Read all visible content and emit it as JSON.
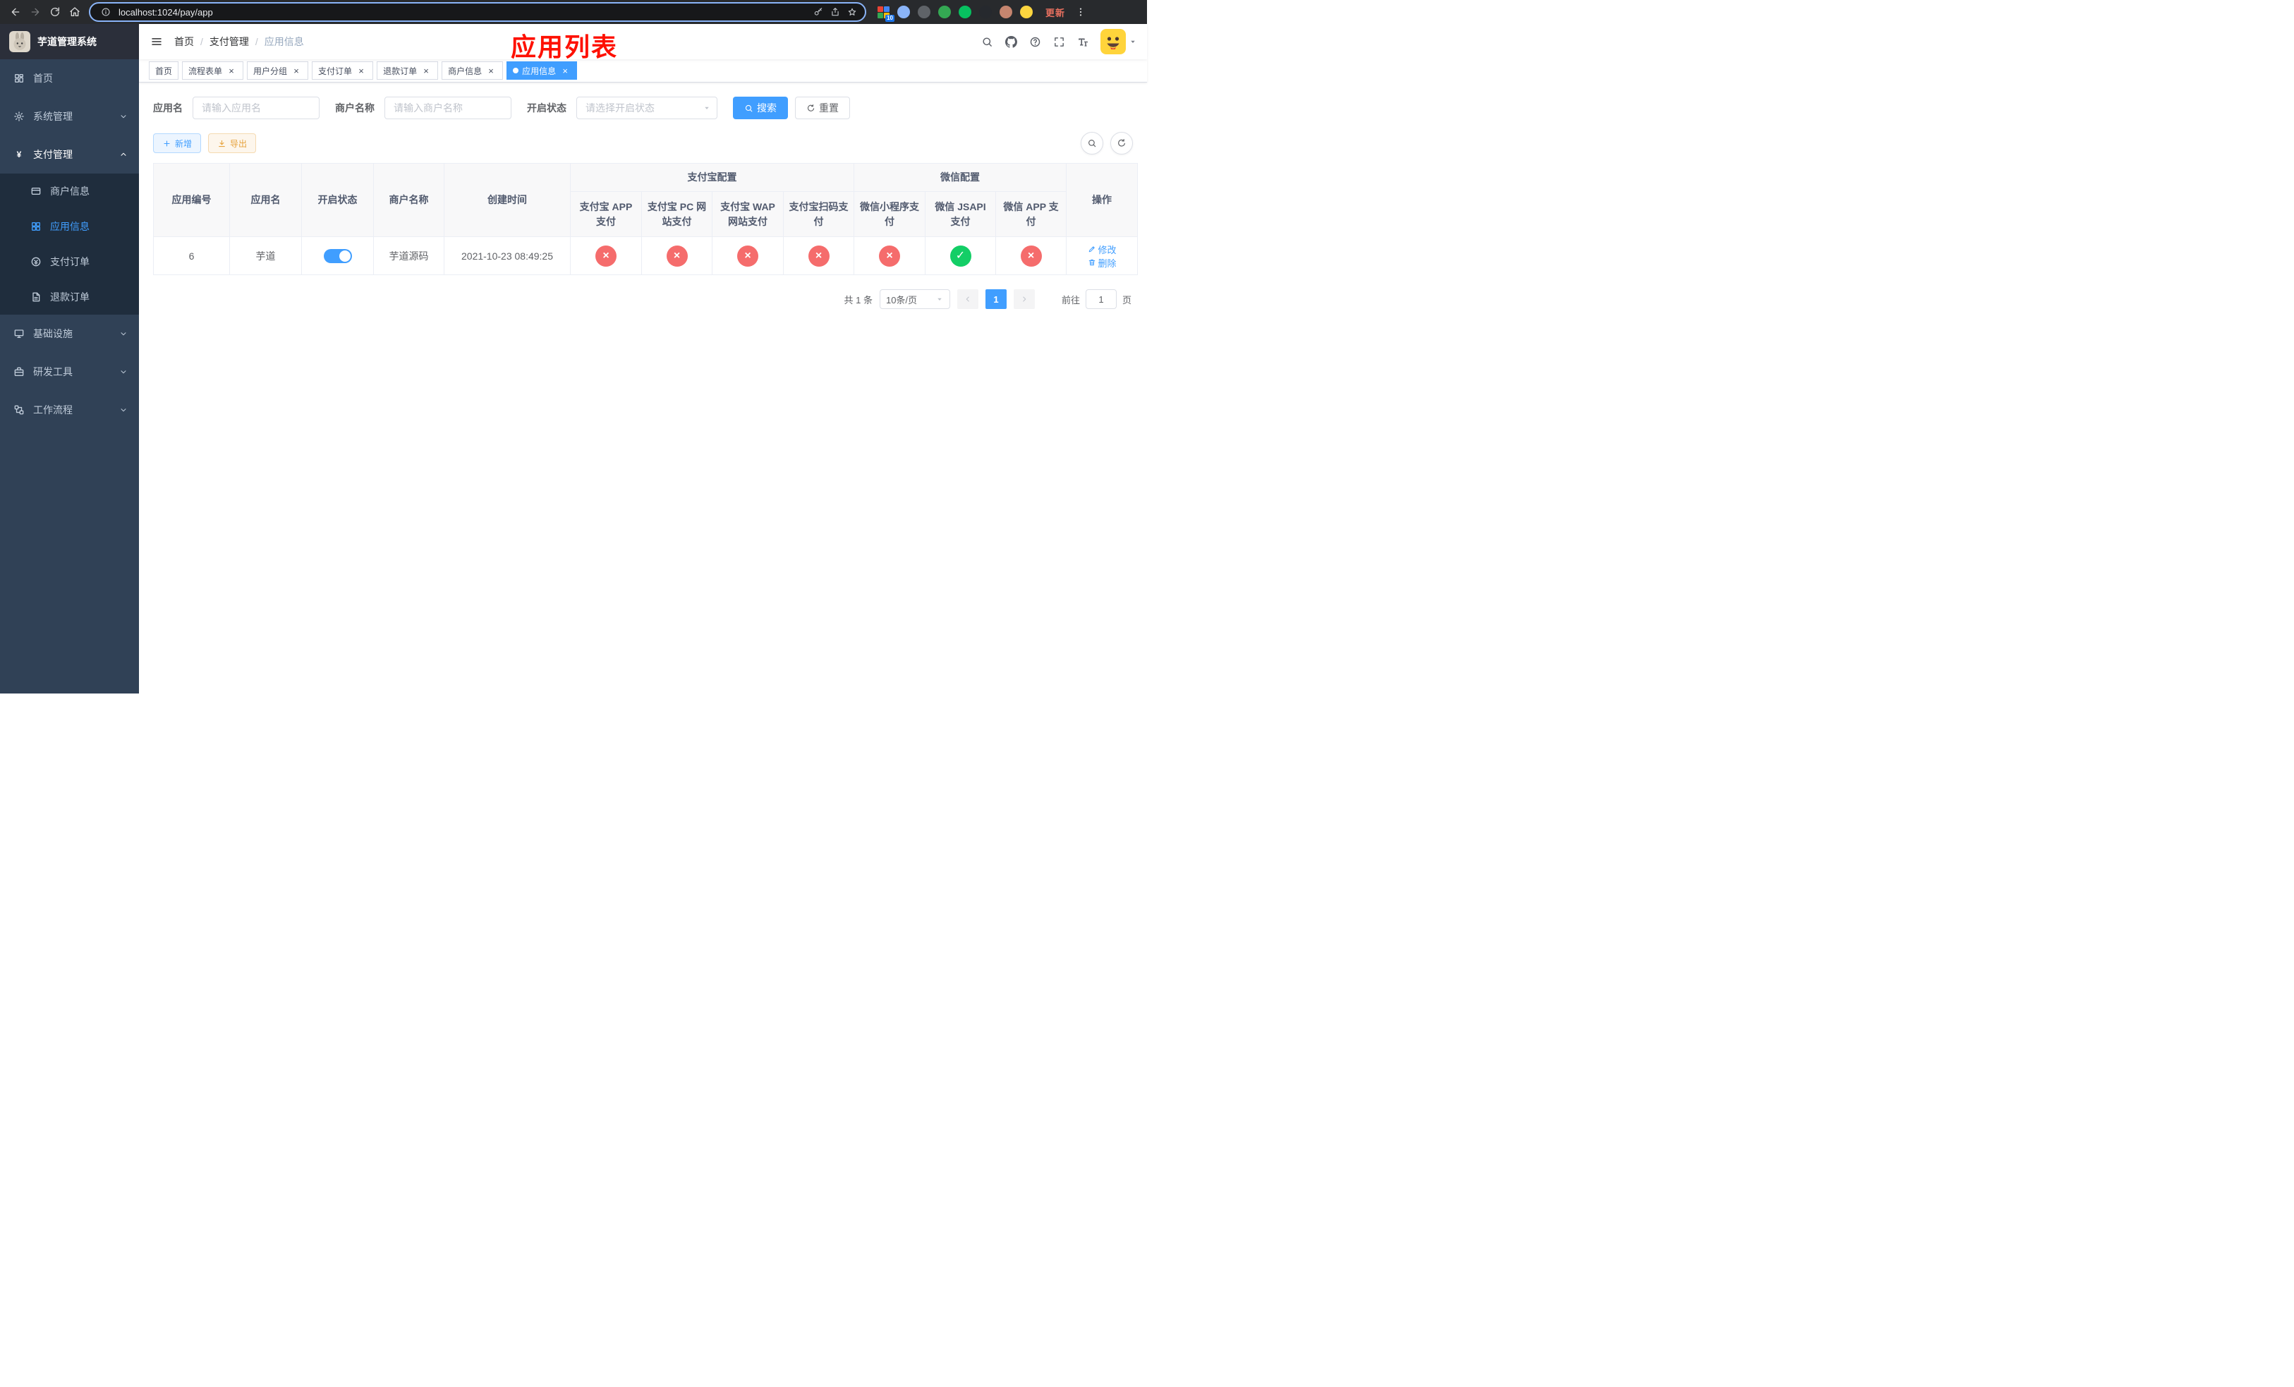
{
  "colors": {
    "accent": "#409eff",
    "success": "#13ce66",
    "danger": "#f56c6c",
    "warning": "#e6a23c",
    "sidebar_bg": "#304156",
    "annotation": "#fe1000"
  },
  "browser": {
    "url": "localhost:1024/pay/app",
    "update_label": "更新",
    "extensions": [
      {
        "name": "extension-grid-icon",
        "type": "grid",
        "badge": "10"
      },
      {
        "name": "extension-icon-blue",
        "color": "#8ab4f8"
      },
      {
        "name": "extension-icon-dark",
        "color": "#5f6368"
      },
      {
        "name": "extension-icon-green-avatar",
        "color": "#34a853"
      },
      {
        "name": "extension-icon-wechat",
        "color": "#07c160"
      },
      {
        "name": "extension-icon-black",
        "color": "#26292e"
      },
      {
        "name": "extension-icon-clay-avatar",
        "color": "#c5856f"
      },
      {
        "name": "extension-icon-emoji",
        "color": "#fcd53f"
      }
    ]
  },
  "sidebar": {
    "title": "芋道管理系统",
    "items": [
      {
        "key": "home",
        "label": "首页",
        "icon": "dashboard",
        "type": "item"
      },
      {
        "key": "system",
        "label": "系统管理",
        "icon": "gear",
        "type": "submenu",
        "expanded": false
      },
      {
        "key": "payment",
        "label": "支付管理",
        "icon": "yen",
        "type": "submenu",
        "expanded": true,
        "active_trail": true,
        "children": [
          {
            "key": "merchant-info",
            "label": "商户信息",
            "icon": "merchant"
          },
          {
            "key": "app-info",
            "label": "应用信息",
            "icon": "appgrid",
            "active": true
          },
          {
            "key": "pay-order",
            "label": "支付订单",
            "icon": "payorder"
          },
          {
            "key": "refund-order",
            "label": "退款订单",
            "icon": "refundorder"
          }
        ]
      },
      {
        "key": "infrastructure",
        "label": "基础设施",
        "icon": "infra",
        "type": "submenu",
        "expanded": false
      },
      {
        "key": "dev-tools",
        "label": "研发工具",
        "icon": "tools",
        "type": "submenu",
        "expanded": false
      },
      {
        "key": "workflow",
        "label": "工作流程",
        "icon": "workflow",
        "type": "submenu",
        "expanded": false
      }
    ]
  },
  "navbar": {
    "breadcrumb": [
      "首页",
      "支付管理",
      "应用信息"
    ]
  },
  "annotation": "应用列表",
  "tabs": [
    {
      "key": "home",
      "label": "首页",
      "closable": false,
      "active": false
    },
    {
      "key": "flow-form",
      "label": "流程表单",
      "closable": true,
      "active": false
    },
    {
      "key": "user-group",
      "label": "用户分组",
      "closable": true,
      "active": false
    },
    {
      "key": "pay-order",
      "label": "支付订单",
      "closable": true,
      "active": false
    },
    {
      "key": "refund-order",
      "label": "退款订单",
      "closable": true,
      "active": false
    },
    {
      "key": "merchant-info",
      "label": "商户信息",
      "closable": true,
      "active": false
    },
    {
      "key": "app-info",
      "label": "应用信息",
      "closable": true,
      "active": true
    }
  ],
  "filters": {
    "app_name_label": "应用名",
    "app_name_placeholder": "请输入应用名",
    "merchant_label": "商户名称",
    "merchant_placeholder": "请输入商户名称",
    "status_label": "开启状态",
    "status_placeholder": "请选择开启状态",
    "search_label": "搜索",
    "reset_label": "重置"
  },
  "actions": {
    "add_label": "新增",
    "export_label": "导出"
  },
  "table": {
    "left_columns": [
      "应用编号",
      "应用名",
      "开启状态",
      "商户名称",
      "创建时间"
    ],
    "groups": [
      {
        "label": "支付宝配置",
        "columns": [
          "支付宝 APP 支付",
          "支付宝 PC 网站支付",
          "支付宝 WAP 网站支付",
          "支付宝扫码支付"
        ]
      },
      {
        "label": "微信配置",
        "columns": [
          "微信小程序支付",
          "微信 JSAPI 支付",
          "微信 APP 支付"
        ]
      }
    ],
    "right_columns": [
      "操作"
    ],
    "rows": [
      {
        "id": "6",
        "name": "芋道",
        "status_on": true,
        "merchant": "芋道源码",
        "created": "2021-10-23 08:49:25",
        "channels": [
          false,
          false,
          false,
          false,
          false,
          true,
          false
        ],
        "edit_label": "修改",
        "delete_label": "删除"
      }
    ]
  },
  "pagination": {
    "total": "共 1 条",
    "page_size": "10条/页",
    "current": "1",
    "goto_label": "前往",
    "goto_value": "1",
    "page_label": "页"
  }
}
